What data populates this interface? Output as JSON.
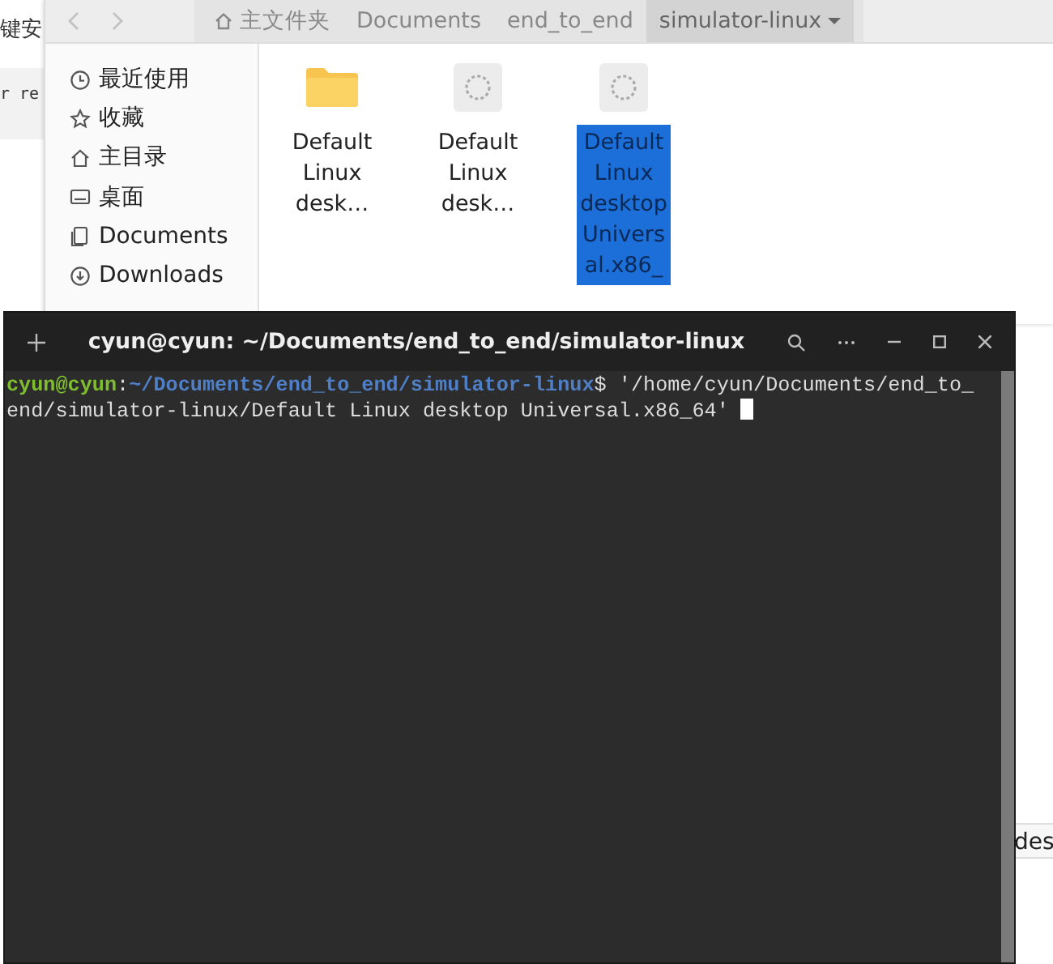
{
  "background_window": {
    "texts": [
      "键安",
      "r re"
    ],
    "button_label": "des"
  },
  "file_manager": {
    "nav": [
      {
        "kind": "back",
        "disabled": true
      },
      {
        "kind": "forward",
        "disabled": true
      }
    ],
    "breadcrumb": [
      {
        "label": "主文件夹",
        "kind": "home",
        "selected": false
      },
      {
        "label": "Documents",
        "kind": "folder",
        "selected": false
      },
      {
        "label": "end_to_end",
        "kind": "folder",
        "selected": false
      },
      {
        "label": "simulator-linux",
        "kind": "dropdown",
        "selected": true
      }
    ],
    "sidebar": {
      "items": [
        {
          "label": "最近使用",
          "kind": "recent"
        },
        {
          "label": "收藏",
          "kind": "starred"
        },
        {
          "label": "主目录",
          "kind": "home"
        },
        {
          "label": "桌面",
          "kind": "desktop"
        },
        {
          "label": "Documents",
          "kind": "documents"
        },
        {
          "label": "Downloads",
          "kind": "downloads"
        }
      ]
    },
    "files": [
      {
        "name": "Default Linux desk…",
        "kind": "folder",
        "selected": false
      },
      {
        "name": "Default Linux desk…",
        "kind": "executable",
        "selected": false
      },
      {
        "name": "Default Linux desktop Universal.x86_",
        "kind": "executable",
        "selected": true
      }
    ]
  },
  "terminal": {
    "title": "cyun@cyun: ~/Documents/end_to_end/simulator-linux",
    "prompt_user": "cyun@cyun",
    "prompt_sep": ":",
    "prompt_path": "~/Documents/end_to_end/simulator-linux",
    "prompt_symbol": "$",
    "command": "'/home/cyun/Documents/end_to_end/simulator-linux/Default Linux desktop Universal.x86_64'"
  }
}
